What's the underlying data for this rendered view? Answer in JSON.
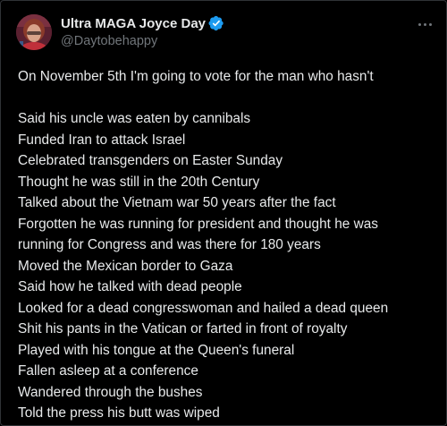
{
  "post": {
    "author": {
      "display_name": "Ultra MAGA Joyce Day",
      "handle": "@Daytobehappy",
      "verified": true,
      "verified_color": "#1d9bf0"
    },
    "more_icon": "more-horizontal-icon",
    "intro": "On November 5th I'm going to vote for the man who hasn't",
    "lines": [
      "Said his uncle was eaten by cannibals",
      "Funded Iran to attack Israel",
      "Celebrated transgenders on Easter Sunday",
      "Thought he was still in the 20th Century",
      "Talked about the Vietnam war 50 years after the fact",
      "Forgotten he was running for president and thought he was",
      "running for Congress and was there for 180 years",
      "Moved the Mexican border to Gaza",
      "Said how he talked with dead people",
      "Looked for a dead congresswoman and hailed a dead queen",
      "Shit his pants in the Vatican or farted in front of royalty",
      "Played with his tongue at the Queen's funeral",
      "Fallen asleep at a conference",
      "Wandered through the bushes",
      "Told the press his butt was wiped"
    ]
  },
  "colors": {
    "background": "#000000",
    "text_primary": "#e7e9ea",
    "text_secondary": "#71767b",
    "border": "#2f3336"
  }
}
